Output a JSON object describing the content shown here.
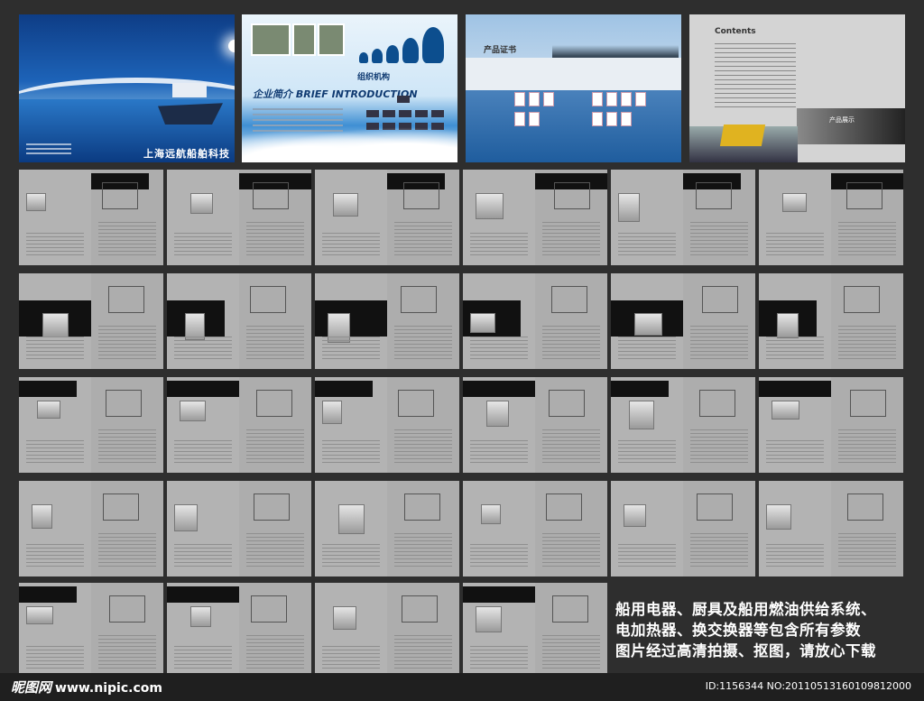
{
  "covers": {
    "cover1_title": "上海远航船舶科技",
    "cover2_heading": "企业简介",
    "cover2_sub": "BRIEF INTRODUCTION",
    "cover2_org": "组织机构",
    "cover3_label": "产品证书",
    "cover4_toc": "Contents",
    "cover4_section": "产品展示"
  },
  "caption": {
    "line1": "船用电器、厨具及船用燃油供给系统、",
    "line2": "电加热器、换交换器等包含所有参数",
    "line3": "图片经过高清拍摄、抠图，请放心下载"
  },
  "footer": {
    "logo": "昵图网",
    "site": "www.nipic.com",
    "id": "ID:1156344 NO:20110513160109812000"
  }
}
